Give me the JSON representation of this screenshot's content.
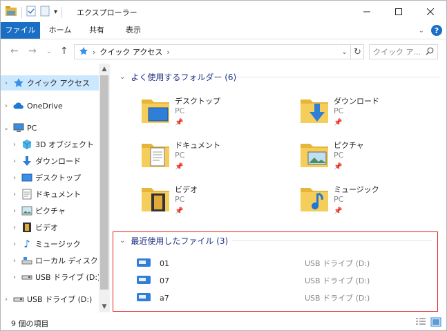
{
  "window": {
    "title": "エクスプローラー"
  },
  "ribbon": {
    "tabs": [
      "ファイル",
      "ホーム",
      "共有",
      "表示"
    ]
  },
  "address": {
    "path": [
      "クイック アクセス"
    ],
    "search_placeholder": "クイック ア..."
  },
  "nav": {
    "items": [
      {
        "label": "クイック アクセス",
        "icon": "star-icon",
        "level": 0,
        "selected": true,
        "arrow": "›"
      },
      {
        "label": "OneDrive",
        "icon": "cloud-icon",
        "level": 0,
        "arrow": "›"
      },
      {
        "label": "PC",
        "icon": "pc-icon",
        "level": 0,
        "arrow": "⌄"
      },
      {
        "label": "3D オブジェクト",
        "icon": "cube-icon",
        "level": 1,
        "arrow": "›"
      },
      {
        "label": "ダウンロード",
        "icon": "download-icon",
        "level": 1,
        "arrow": "›"
      },
      {
        "label": "デスクトップ",
        "icon": "desktop-icon",
        "level": 1,
        "arrow": "›"
      },
      {
        "label": "ドキュメント",
        "icon": "document-icon",
        "level": 1,
        "arrow": "›"
      },
      {
        "label": "ピクチャ",
        "icon": "picture-icon",
        "level": 1,
        "arrow": "›"
      },
      {
        "label": "ビデオ",
        "icon": "video-icon",
        "level": 1,
        "arrow": "›"
      },
      {
        "label": "ミュージック",
        "icon": "music-icon",
        "level": 1,
        "arrow": "›"
      },
      {
        "label": "ローカル ディスク (C",
        "icon": "disk-icon",
        "level": 1,
        "arrow": "›"
      },
      {
        "label": "USB ドライブ (D:)",
        "icon": "usb-icon",
        "level": 1,
        "arrow": "›"
      },
      {
        "label": "USB ドライブ (D:)",
        "icon": "usb-icon",
        "level": 0,
        "arrow": "›"
      }
    ]
  },
  "frequent": {
    "header": "よく使用するフォルダー (6)",
    "folders": [
      {
        "name": "デスクトップ",
        "location": "PC",
        "icon": "desktop-folder-icon"
      },
      {
        "name": "ダウンロード",
        "location": "PC",
        "icon": "download-folder-icon"
      },
      {
        "name": "ドキュメント",
        "location": "PC",
        "icon": "document-folder-icon"
      },
      {
        "name": "ピクチャ",
        "location": "PC",
        "icon": "picture-folder-icon"
      },
      {
        "name": "ビデオ",
        "location": "PC",
        "icon": "video-folder-icon"
      },
      {
        "name": "ミュージック",
        "location": "PC",
        "icon": "music-folder-icon"
      }
    ]
  },
  "recent": {
    "header": "最近使用したファイル (3)",
    "files": [
      {
        "name": "01",
        "location": "USB ドライブ (D:)"
      },
      {
        "name": "07",
        "location": "USB ドライブ (D:)"
      },
      {
        "name": "a7",
        "location": "USB ドライブ (D:)"
      }
    ]
  },
  "status": {
    "count": "9 個の項目"
  },
  "colors": {
    "accent": "#1a6fc4",
    "selected": "#cce8ff",
    "header_text": "#1e3287",
    "highlight_border": "#e01b1b"
  }
}
